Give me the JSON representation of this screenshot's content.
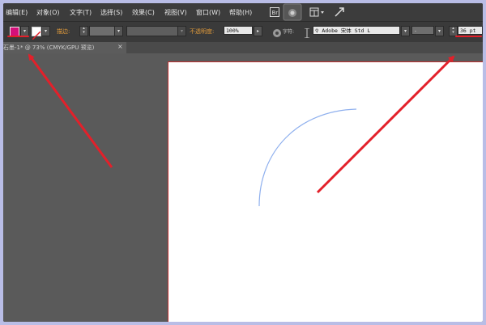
{
  "menubar": {
    "items": [
      "编辑(E)",
      "对象(O)",
      "文字(T)",
      "选择(S)",
      "效果(C)",
      "视图(V)",
      "窗口(W)",
      "帮助(H)"
    ],
    "icons": [
      "bridge-icon",
      "stock-icon",
      "arrange-documents-icon",
      "arrow-pointer-icon"
    ]
  },
  "options_bar": {
    "fill_color": "#d4107a",
    "stroke_label": "描边:",
    "opacity_label": "不透明度:",
    "opacity_value": "100%",
    "font_family": "Adobe 宋体 Std L",
    "font_style": "-",
    "font_size": "36 pt"
  },
  "document_tab": {
    "title": "石墨-1* @ 73% (CMYK/GPU 预览)",
    "close": "×"
  },
  "colors": {
    "accent_red": "#e3202a",
    "artboard_border": "#c03030",
    "arc_stroke": "#8fb0ee"
  }
}
